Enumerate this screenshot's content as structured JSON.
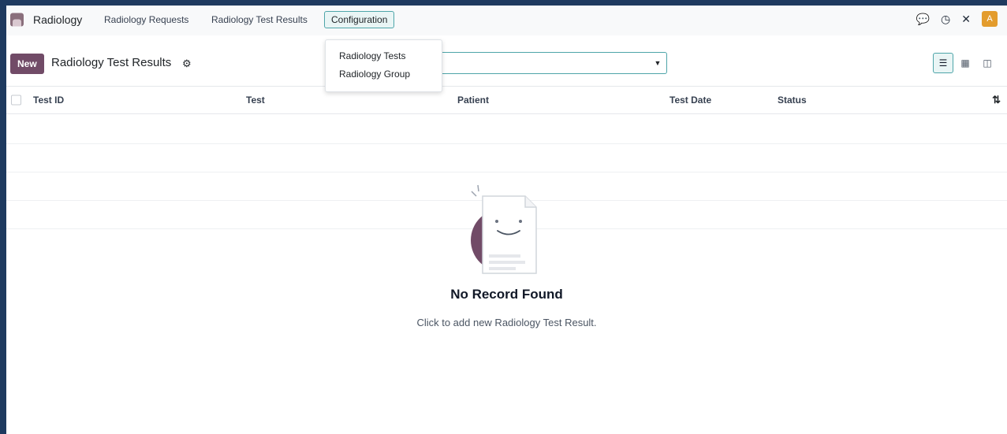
{
  "navbar": {
    "app_name": "Radiology",
    "menus": [
      "Radiology Requests",
      "Radiology Test Results",
      "Configuration"
    ],
    "avatar_letter": "A"
  },
  "configuration_menu": {
    "items": [
      "Radiology Tests",
      "Radiology Group"
    ]
  },
  "control_panel": {
    "new_label": "New",
    "title": "Radiology Test Results"
  },
  "table": {
    "columns": [
      "Test ID",
      "Test",
      "Patient",
      "Test Date",
      "Status"
    ]
  },
  "empty_state": {
    "title": "No Record Found",
    "subtitle": "Click to add new Radiology Test Result."
  },
  "colors": {
    "brand": "#714b67",
    "accent": "#4ea5a9",
    "avatar": "#e39c2d"
  },
  "icons": [
    "app-icon",
    "chat-icon",
    "clock-icon",
    "tools-icon",
    "gear-icon",
    "caret-down-icon",
    "list-view-icon",
    "calendar-view-icon",
    "pivot-view-icon",
    "column-settings-icon"
  ]
}
